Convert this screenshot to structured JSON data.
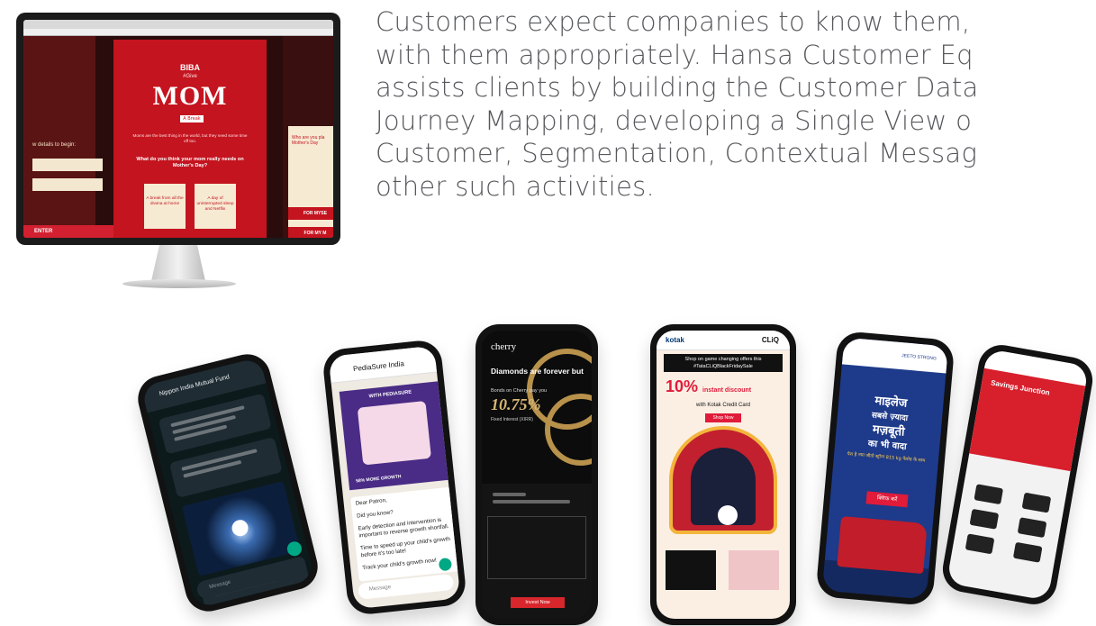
{
  "description": {
    "lines": [
      "Customers expect companies to know them,",
      "with them appropriately. Hansa Customer Eq",
      "assists clients by building the Customer Data",
      "Journey Mapping, developing a Single View o",
      "Customer, Segmentation, Contextual Messag",
      "other such activities."
    ]
  },
  "monitor": {
    "brand": "BIBA",
    "tag": "#Give",
    "headline": "MOM",
    "badge": "A Break",
    "copy": "Moms are the best thing in the world, but they need some time off too.",
    "question": "What do you think your mom really needs on Mother's Day?",
    "option_1": "A break from all the drama at home",
    "option_2": "A day of uninterrupted sleep and Netflix",
    "left_header": "w details to begin:",
    "enter_label": "ENTER",
    "right_q": "Who are you pla Mother's Day",
    "right_btn_1": "FOR MYSE",
    "right_btn_2": "FOR MY M"
  },
  "phone_whatsapp": {
    "contact": "Nippon India Mutual Fund",
    "input_placeholder": "Message"
  },
  "phone_pediasure": {
    "contact": "PediaSure India",
    "banner_title": "WITH PEDIASURE",
    "banner_growth": "58% MORE GROWTH",
    "messages": [
      "Dear Patron,",
      "Did you know?",
      "Early detection and intervention is important to reverse growth shortfall.",
      "Time to speed up your child's growth before it's too late!",
      "Track your child's growth now!"
    ],
    "input_placeholder": "Message"
  },
  "phone_cherry": {
    "logo": "cherry",
    "headline": "Diamonds are forever but",
    "sub": "Bonds on Cherry pay you",
    "rate": "10.75%",
    "rate_note": "Fixed Interest (XIRR)",
    "cta": "Invest Now"
  },
  "phone_kotak": {
    "brand_left": "kotak",
    "brand_right": "CLiQ",
    "offer": "Shop on game changing offers this #TataCLiQBlackFridaySale",
    "discount": "10%",
    "discount_suffix": "instant discount",
    "card_line": "with Kotak Credit Card",
    "shop_now": "Shop Now"
  },
  "phone_jeeto": {
    "brand": "JEETO STRONG",
    "headline_1": "माइलेज",
    "headline_2": "सबसे ज़्यादा",
    "headline_3": "मज़बूती",
    "headline_4": "का भी वादा",
    "sub": "पेश है नया जीतो स्ट्रॉन्ग 815 kg पेलोड के साथ",
    "button": "क्लिक करें"
  },
  "phone_savings": {
    "hero_title": "Savings Junction"
  }
}
